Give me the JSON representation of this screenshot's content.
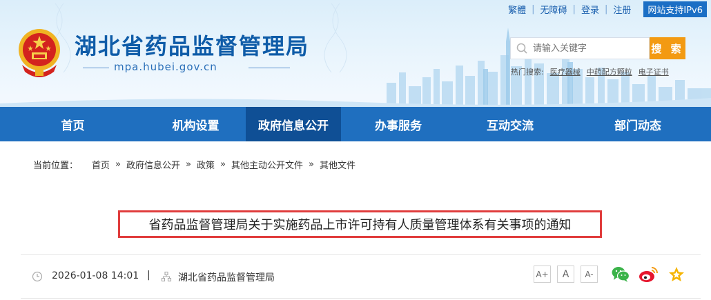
{
  "topbar": {
    "traditional": "繁體",
    "accessible": "无障碍",
    "login": "登录",
    "register": "注册",
    "ipv6": "网站支持IPv6"
  },
  "site": {
    "title": "湖北省药品监督管理局",
    "domain": "mpa.hubei.gov.cn"
  },
  "search": {
    "placeholder": "请输入关键字",
    "button": "搜 索",
    "hot_label": "热门搜索:",
    "hot_items": [
      "医疗器械",
      "中药配方颗粒",
      "电子证书"
    ]
  },
  "nav": {
    "items": [
      "首页",
      "机构设置",
      "政府信息公开",
      "办事服务",
      "互动交流",
      "部门动态"
    ],
    "active_index": 2
  },
  "breadcrumb": {
    "label": "当前位置：",
    "items": [
      "首页",
      "政府信息公开",
      "政策",
      "其他主动公开文件",
      "其他文件"
    ]
  },
  "article": {
    "title": "省药品监督管理局关于实施药品上市许可持有人质量管理体系有关事项的通知",
    "date": "2026-01-08 14:01",
    "separator": "|",
    "source": "湖北省药品监督管理局"
  },
  "font_buttons": [
    "A+",
    "A",
    "A-"
  ],
  "share": [
    "wechat-icon",
    "weibo-icon",
    "favorite-star-icon"
  ],
  "colors": {
    "brand_blue": "#1f6fbf",
    "nav_active": "#0f4f95",
    "search_orange": "#f39a12",
    "highlight_red": "#e03c3c"
  }
}
